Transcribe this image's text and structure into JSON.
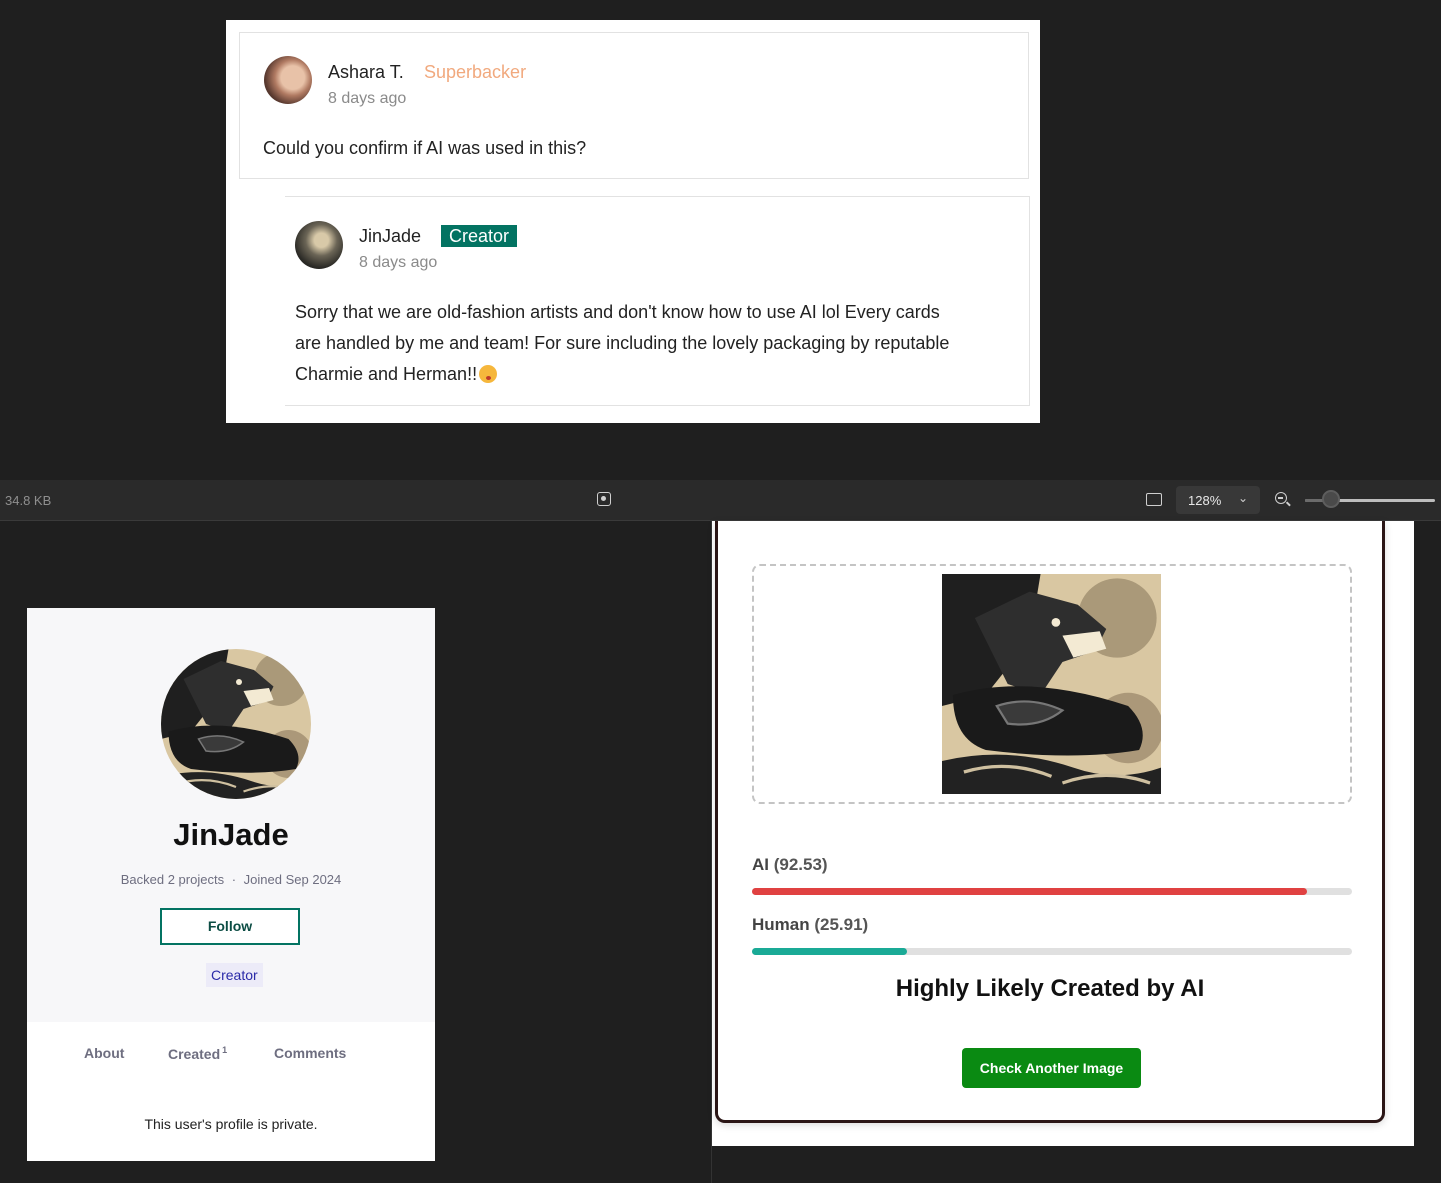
{
  "comment": {
    "author": "Ashara T.",
    "badge": "Superbacker",
    "time": "8 days ago",
    "text": "Could you confirm if AI was used in this?"
  },
  "reply": {
    "author": "JinJade",
    "badge": "Creator",
    "time": "8 days ago",
    "line1": "Sorry that we are old-fashion artists and don't know how to use AI lol Every cards",
    "line2": "are handled by me and team! For sure including the lovely packaging by reputable",
    "line3": "Charmie and Herman!!",
    "emoji": "kissing-face-emoji"
  },
  "viewer_toolbar": {
    "file_size": "34.8 KB",
    "zoom_value": "128%",
    "zoom_level": 0.2,
    "icons": [
      "focus-icon",
      "fit-to-screen-icon",
      "chevron-down-icon",
      "zoom-out-icon"
    ]
  },
  "profile": {
    "name": "JinJade",
    "backed": "Backed 2 projects",
    "separator": "·",
    "joined": "Joined Sep 2024",
    "follow_label": "Follow",
    "role_tag": "Creator",
    "tabs": {
      "about": "About",
      "created": "Created",
      "created_count": "1",
      "comments": "Comments"
    },
    "private_message": "This user's profile is private."
  },
  "detector": {
    "ai_label": "AI",
    "ai_score": "(92.53)",
    "ai_fraction": 0.9253,
    "human_label": "Human",
    "human_score": "(25.91)",
    "human_fraction": 0.2591,
    "verdict": "Highly Likely Created by AI",
    "button_label": "Check Another Image"
  },
  "colors": {
    "creator_green": "#037362",
    "superbacker_orange": "#f1a97e",
    "ai_bar": "#e04141",
    "human_bar": "#1aaa96",
    "button_green": "#0a8a12"
  }
}
